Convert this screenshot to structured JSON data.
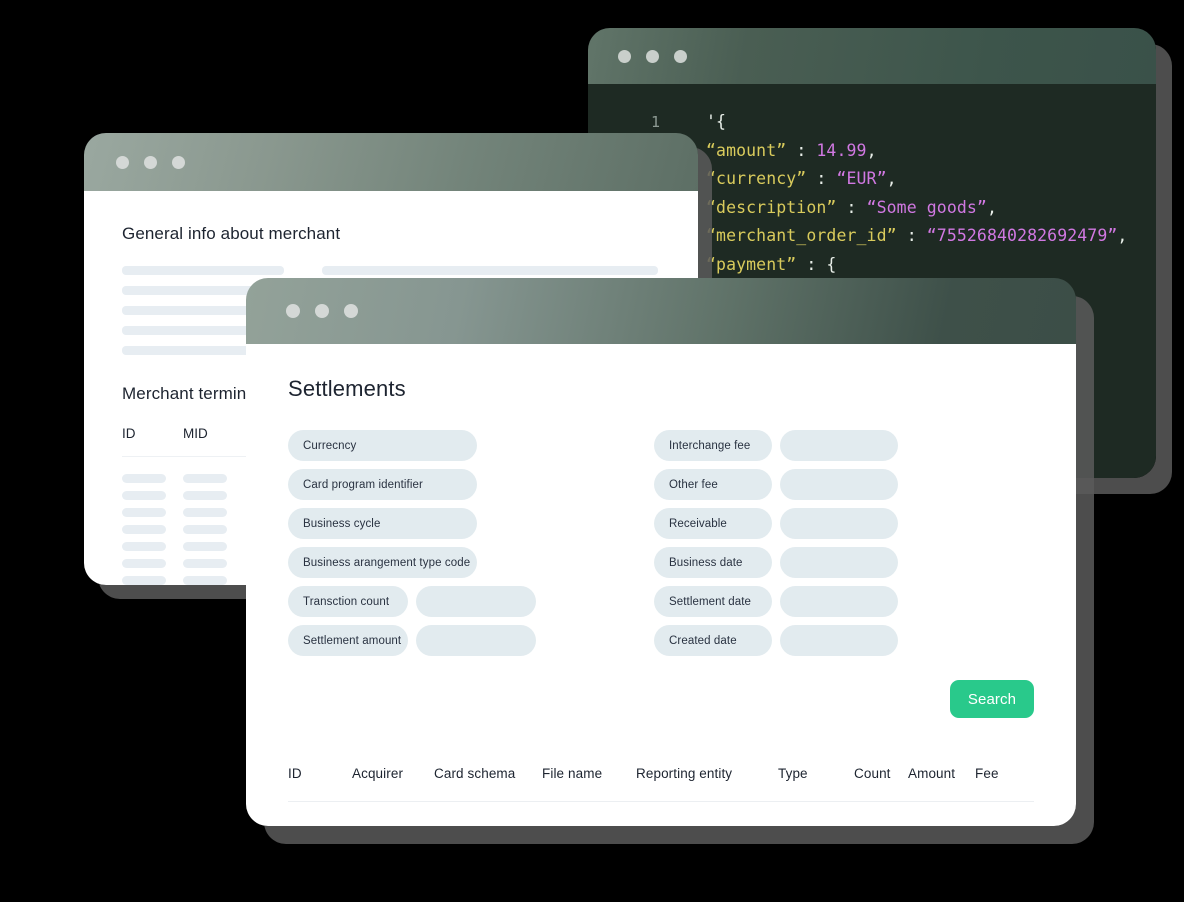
{
  "background_color": "#000000",
  "accent_color": "#29c98b",
  "windows": {
    "code": {
      "name": "code-viewer-window",
      "titlebar_dots": [
        "close-dot",
        "minimize-dot",
        "maximize-dot"
      ],
      "lines": [
        {
          "number": "1",
          "segments": [
            {
              "type": "punct",
              "text": "'{"
            }
          ]
        },
        {
          "number": "",
          "segments": [
            {
              "type": "key",
              "text": "“amount”"
            },
            {
              "type": "punct",
              "text": " : "
            },
            {
              "type": "num",
              "text": "14.99"
            },
            {
              "type": "punct",
              "text": ","
            }
          ]
        },
        {
          "number": "",
          "segments": [
            {
              "type": "key",
              "text": "“currency”"
            },
            {
              "type": "punct",
              "text": " : "
            },
            {
              "type": "val",
              "text": "“EUR”"
            },
            {
              "type": "punct",
              "text": ","
            }
          ]
        },
        {
          "number": "",
          "segments": [
            {
              "type": "key",
              "text": "“description”"
            },
            {
              "type": "punct",
              "text": " : "
            },
            {
              "type": "val",
              "text": "“Some goods”"
            },
            {
              "type": "punct",
              "text": ","
            }
          ]
        },
        {
          "number": "",
          "segments": [
            {
              "type": "key",
              "text": "“merchant_order_id”"
            },
            {
              "type": "punct",
              "text": " : "
            },
            {
              "type": "val",
              "text": "“75526840282692479”"
            },
            {
              "type": "punct",
              "text": ","
            }
          ]
        },
        {
          "number": "",
          "segments": [
            {
              "type": "key",
              "text": "“payment”"
            },
            {
              "type": "punct",
              "text": " : {"
            }
          ]
        }
      ]
    },
    "merchant": {
      "name": "merchant-info-window",
      "general_info_title": "General info about merchant",
      "terminals_title": "Merchant terminals",
      "terminals_columns": [
        "ID",
        "MID"
      ],
      "terminals_row_count": 8,
      "skeleton_left_rows": 5,
      "skeleton_right_rows": 2
    },
    "settlements": {
      "name": "settlements-window",
      "title": "Settlements",
      "left_fields": [
        {
          "label": "Currecncy",
          "has_input": false
        },
        {
          "label": "Card program identifier",
          "has_input": false
        },
        {
          "label": "Business cycle",
          "has_input": false
        },
        {
          "label": "Business arangement type code",
          "has_input": false
        },
        {
          "label": "Transction count",
          "has_input": true
        },
        {
          "label": "Settlement amount",
          "has_input": true
        }
      ],
      "right_fields": [
        {
          "label": "Interchange fee",
          "has_input": true
        },
        {
          "label": "Other fee",
          "has_input": true
        },
        {
          "label": "Receivable",
          "has_input": true
        },
        {
          "label": "Business date",
          "has_input": true
        },
        {
          "label": "Settlement date",
          "has_input": true
        },
        {
          "label": "Created date",
          "has_input": true
        }
      ],
      "search_label": "Search",
      "table_columns": [
        {
          "label": "ID",
          "width": 64
        },
        {
          "label": "Acquirer",
          "width": 82
        },
        {
          "label": "Card schema",
          "width": 108
        },
        {
          "label": "File name",
          "width": 94
        },
        {
          "label": "Reporting entity",
          "width": 142
        },
        {
          "label": "Type",
          "width": 76
        },
        {
          "label": "Count",
          "width": 54
        },
        {
          "label": "Amount",
          "width": 67
        },
        {
          "label": "Fee",
          "width": 44
        }
      ]
    }
  }
}
